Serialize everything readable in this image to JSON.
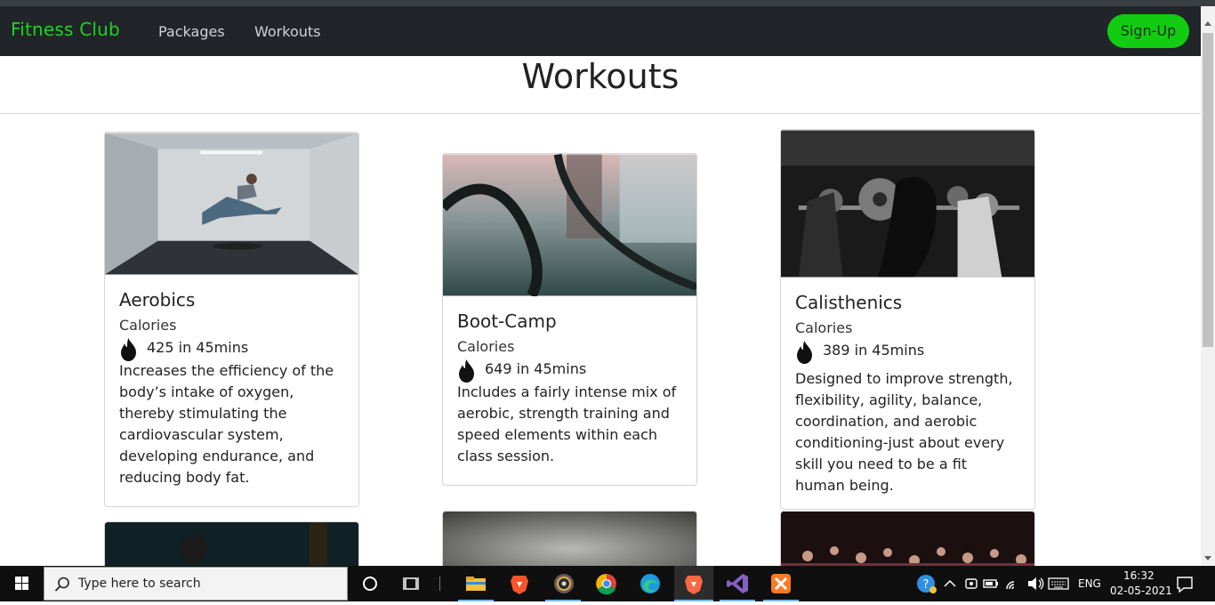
{
  "navbar": {
    "brand": "Fitness Club",
    "links": [
      "Packages",
      "Workouts"
    ],
    "signup": "Sign-Up"
  },
  "page": {
    "title": "Workouts"
  },
  "cards": [
    {
      "title": "Aerobics",
      "calories_label": "Calories",
      "calories": "425 in 45mins",
      "text": "Increases the efficiency of the body’s intake of oxygen, thereby stimulating the cardiovascular system, developing endurance, and reducing body fat."
    },
    {
      "title": "Boot-Camp",
      "calories_label": "Calories",
      "calories": "649 in 45mins",
      "text": "Includes a fairly intense mix of aerobic, strength training and speed elements within each class session."
    },
    {
      "title": "Calisthenics",
      "calories_label": "Calories",
      "calories": "389 in 45mins",
      "text": "Designed to improve strength, flexibility, agility, balance, coordination, and aerobic conditioning-just about every skill you need to be a fit human being."
    }
  ],
  "taskbar": {
    "search_placeholder": "Type here to search",
    "icons": [
      "windows-start-icon",
      "search-icon",
      "cortana-icon",
      "task-view-icon",
      "file-explorer-icon",
      "brave-icon",
      "media-player-icon",
      "chrome-icon",
      "edge-icon",
      "brave-icon",
      "visual-studio-icon",
      "xampp-icon"
    ],
    "language": "ENG",
    "time": "16:32",
    "date": "02-05-2021"
  },
  "colors": {
    "navbar_bg": "#212529",
    "brand": "#1ed41e",
    "signup_bg": "#12cc12"
  }
}
